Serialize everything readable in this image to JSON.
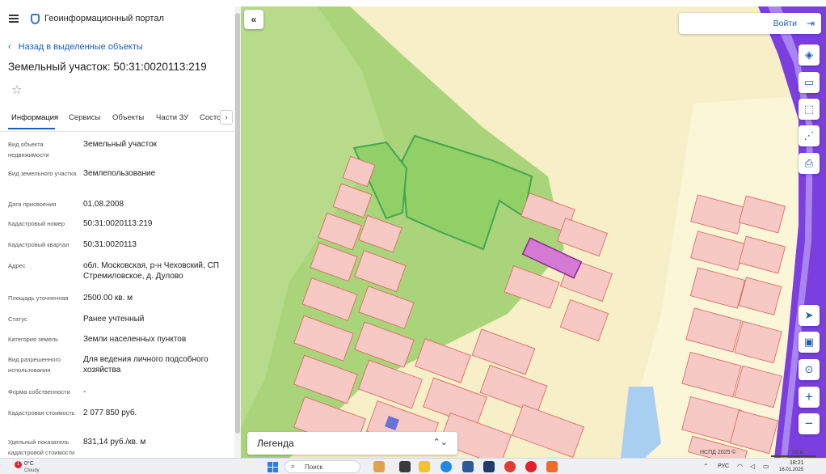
{
  "header": {
    "title": "Геоинформационный портал"
  },
  "nav": {
    "back_label": "Назад в выделенные объекты"
  },
  "parcel": {
    "title": "Земельный участок: 50:31:0020113:219"
  },
  "tabs": [
    {
      "label": "Информация",
      "active": true
    },
    {
      "label": "Сервисы",
      "active": false
    },
    {
      "label": "Объекты",
      "active": false
    },
    {
      "label": "Части ЗУ",
      "active": false
    },
    {
      "label": "Состо",
      "active": false
    }
  ],
  "info_rows": [
    {
      "label": "Вид объекта недвижимости",
      "value": "Земельный участок"
    },
    {
      "label": "Вид земельного участка",
      "value": "Землепользование"
    },
    {
      "label": "Дата присвоения",
      "value": "01.08.2008"
    },
    {
      "label": "Кадастровый номер",
      "value": "50:31:0020113:219"
    },
    {
      "label": "Кадастровый квартал",
      "value": "50:31:0020113"
    },
    {
      "label": "Адрес",
      "value": "обл. Московская, р-н Чеховский, СП Стремиловское, д. Дулово"
    },
    {
      "label": "Площадь уточненная",
      "value": "2500.00 кв. м"
    },
    {
      "label": "Статус",
      "value": "Ранее учтенный"
    },
    {
      "label": "Категория земель",
      "value": "Земли населенных пунктов"
    },
    {
      "label": "Вид разрешенного использования",
      "value": "Для ведения личного подсобного хозяйства"
    },
    {
      "label": "Форма собственности",
      "value": "-"
    },
    {
      "label": "Кадастровая стоимость",
      "value": "2 077 850 руб."
    },
    {
      "label": "Удельный показатель кадастровой стоимости",
      "value": "831,14 руб./кв. м"
    }
  ],
  "map": {
    "login_label": "Войти",
    "legend_label": "Легенда",
    "attribution": "НСПД 2025 ©",
    "scale_label": "50 м",
    "colors": {
      "forest": "#a9d47a",
      "field": "#f6efc8",
      "parcel_fill": "#f7c9c5",
      "parcel_stroke": "#d9615b",
      "selected": "#d57ad4",
      "road": "#7b3fe0",
      "water": "#a9cff0"
    }
  },
  "taskbar": {
    "weather_temp": "0°C",
    "weather_cond": "Cloudy",
    "weather_badge": "1",
    "search_label": "Поиск",
    "lang": "РУС",
    "time": "18:21",
    "date": "16.01.2025"
  },
  "icons": {
    "menu": "hamburger-icon",
    "back": "chevron-left-icon",
    "favorite": "star-icon",
    "collapse": "double-chevron-left-icon",
    "login": "login-icon",
    "layers": "layers-icon",
    "ruler": "ruler-icon",
    "select": "select-area-icon",
    "share": "share-icon",
    "print": "print-icon",
    "locate": "locate-icon",
    "minimap": "minimap-icon",
    "geo": "geo-pin-icon",
    "zoom_in": "plus-icon",
    "zoom_out": "minus-icon"
  }
}
